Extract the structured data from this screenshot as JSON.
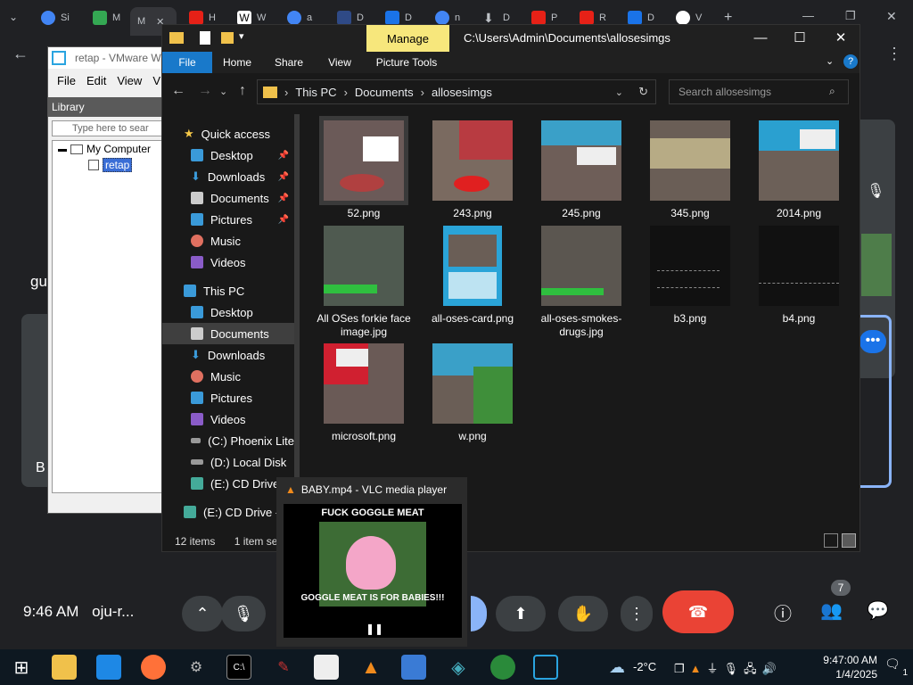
{
  "browser": {
    "tabs": [
      "Si",
      "M",
      "M",
      "H",
      "W",
      "a",
      "D",
      "D",
      "n",
      "D",
      "P",
      "R",
      "D",
      "V"
    ],
    "new_tab": "+"
  },
  "meet": {
    "left_text_gu": "gu",
    "left_text_b": "B",
    "time": "9:46 AM",
    "meeting_code": "oju-r...",
    "participants_count": "7"
  },
  "vmware": {
    "title": "retap - VMware W",
    "menu": [
      "File",
      "Edit",
      "View",
      "V"
    ],
    "library_label": "Library",
    "search_placeholder": "Type here to sear",
    "tree": {
      "root": "My Computer",
      "child": "retap"
    }
  },
  "explorer": {
    "manage": "Manage",
    "title_path": "C:\\Users\\Admin\\Documents\\allosesimgs",
    "ribbon_tabs": [
      "File",
      "Home",
      "Share",
      "View",
      "Picture Tools"
    ],
    "breadcrumb": [
      "This PC",
      "Documents",
      "allosesimgs"
    ],
    "search_placeholder": "Search allosesimgs",
    "nav": {
      "quick_access": "Quick access",
      "qa_items": [
        "Desktop",
        "Downloads",
        "Documents",
        "Pictures",
        "Music",
        "Videos"
      ],
      "this_pc": "This PC",
      "pc_items": [
        "Desktop",
        "Documents",
        "Downloads",
        "Music",
        "Pictures",
        "Videos",
        "(C:) Phoenix Lite",
        "(D:) Local Disk",
        "(E:) CD Drive -",
        "(E:) CD Drive - IF"
      ]
    },
    "files": [
      {
        "name": "52.png"
      },
      {
        "name": "243.png"
      },
      {
        "name": "245.png"
      },
      {
        "name": "345.png"
      },
      {
        "name": "2014.png"
      },
      {
        "name": "All OSes forkie face image.jpg"
      },
      {
        "name": "all-oses-card.png"
      },
      {
        "name": "all-oses-smokes-drugs.jpg"
      },
      {
        "name": "b3.png"
      },
      {
        "name": "b4.png"
      },
      {
        "name": "microsoft.png"
      },
      {
        "name": "w.png"
      }
    ],
    "status_count": "12 items",
    "status_sel": "1 item sel"
  },
  "vlc": {
    "title": "BABY.mp4 - VLC media player",
    "caption_top": "FUCK GOGGLE MEAT",
    "caption_bottom": "GOGGLE MEAT IS FOR BABIES!!!"
  },
  "taskbar": {
    "temperature": "-2°C",
    "time": "9:47:00 AM",
    "date": "1/4/2025",
    "notification_count": "1"
  },
  "colors": {
    "accent_blue": "#1979ca",
    "manage_yellow": "#f7e77c",
    "end_call_red": "#ea4335"
  }
}
